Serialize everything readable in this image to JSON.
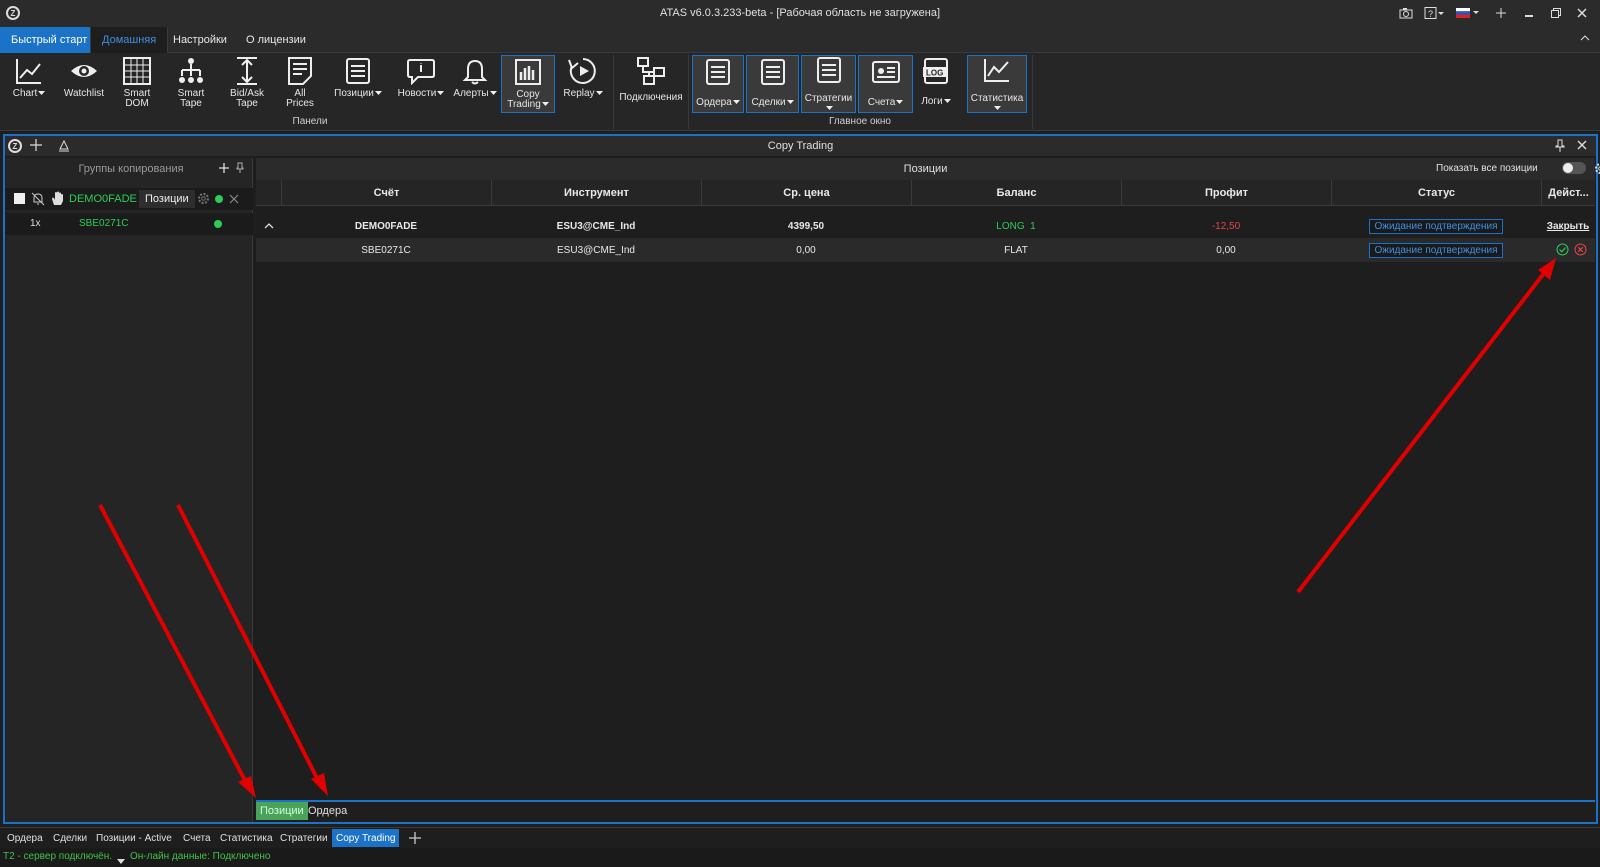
{
  "window": {
    "title": "ATAS v6.0.3.233-beta - [Рабочая область не загружена]",
    "logo": "Z"
  },
  "menu": {
    "tabs": [
      "Быстрый старт",
      "Домашняя",
      "Настройки",
      "О лицензии"
    ]
  },
  "ribbon": {
    "panels_buttons": [
      {
        "label": "Chart",
        "icon": "chart-icon",
        "dropdown": true
      },
      {
        "label": "Watchlist",
        "icon": "eye-icon",
        "dropdown": false
      },
      {
        "label": "Smart\nDOM",
        "icon": "grid-icon",
        "dropdown": false
      },
      {
        "label": "Smart\nTape",
        "icon": "tree-icon",
        "dropdown": false
      },
      {
        "label": "Bid/Ask\nTape",
        "icon": "bidask-icon",
        "dropdown": false
      },
      {
        "label": "All\nPrices",
        "icon": "list-icon",
        "dropdown": false
      },
      {
        "label": "Позиции",
        "icon": "doc-icon",
        "dropdown": true
      },
      {
        "label": "Новости",
        "icon": "news-icon",
        "dropdown": true
      },
      {
        "label": "Алерты",
        "icon": "bell-icon",
        "dropdown": true
      },
      {
        "label": "Copy\nTrading",
        "icon": "copy-trading-icon",
        "dropdown": true
      },
      {
        "label": "Replay",
        "icon": "replay-icon",
        "dropdown": true
      }
    ],
    "panels_group": "Панели",
    "connections": "Подключения",
    "main_buttons": [
      {
        "label": "Ордера",
        "icon": "doc-icon"
      },
      {
        "label": "Сделки",
        "icon": "doc-icon"
      },
      {
        "label": "Стратегии",
        "icon": "doc-icon"
      },
      {
        "label": "Счета",
        "icon": "account-icon"
      },
      {
        "label": "Логи",
        "icon": "log-icon"
      },
      {
        "label": "Статистика",
        "icon": "stats-icon"
      }
    ],
    "main_group": "Главное окно"
  },
  "panel": {
    "title": "Copy Trading"
  },
  "left": {
    "header": "Группы копирования",
    "group": {
      "name": "DEMO0FADE",
      "tab": "Позиции"
    },
    "sub": {
      "mult": "1x",
      "name": "SBE0271C"
    }
  },
  "right": {
    "title": "Позиции",
    "show_all": "Показать все позиции",
    "columns": [
      "Счёт",
      "Инструмент",
      "Ср. цена",
      "Баланс",
      "Профит",
      "Статус",
      "Дейст..."
    ],
    "rows": [
      {
        "account": "DEMO0FADE",
        "instrument": "ESU3@CME_Ind",
        "avg": "4399,50",
        "balance": "LONG  1",
        "profit": "-12,50",
        "status": "Ожидание подтверждения",
        "action": "Закрыть"
      },
      {
        "account": "SBE0271C",
        "instrument": "ESU3@CME_Ind",
        "avg": "0,00",
        "balance": "FLAT",
        "profit": "0,00",
        "status": "Ожидание подтверждения",
        "action": ""
      }
    ],
    "inner_tabs": [
      "Позиции",
      "Ордера"
    ]
  },
  "bottom_tabs": [
    "Ордера",
    "Сделки",
    "Позиции - Active",
    "Счета",
    "Статистика",
    "Стратегии",
    "Copy Trading"
  ],
  "status": {
    "server": "T2 - сервер подключён.",
    "online": "Он-лайн данные: Подключено"
  },
  "colors": {
    "accent": "#1a73c8",
    "positive": "#2ecc5a",
    "negative": "#e04848"
  }
}
